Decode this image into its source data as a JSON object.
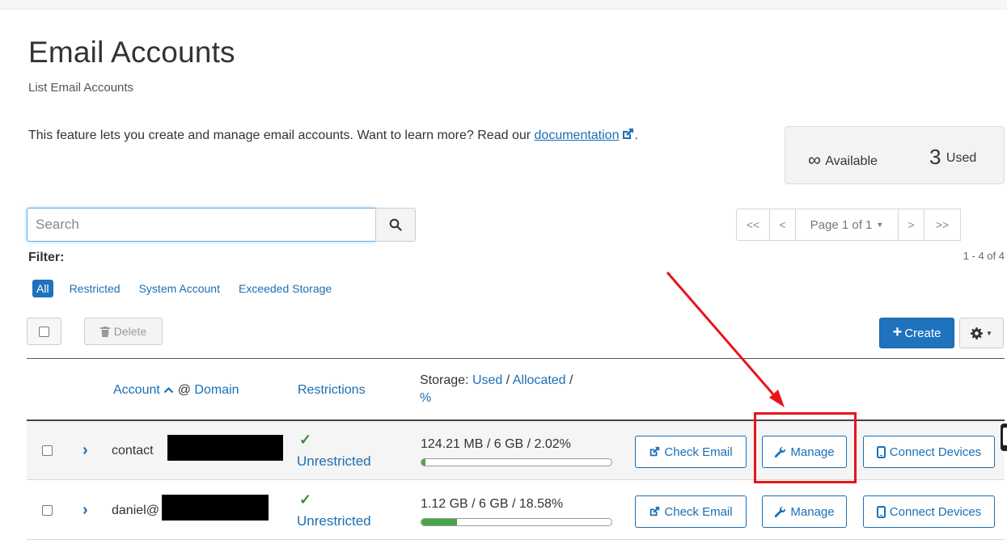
{
  "page": {
    "title": "Email Accounts",
    "subtitle": "List Email Accounts",
    "intro_text": "This feature lets you create and manage email accounts. Want to learn more? Read our ",
    "intro_link": "documentation",
    "intro_tail": "."
  },
  "stats": {
    "available_symbol": "∞",
    "available_label": "Available",
    "used_count": "3",
    "used_label": "Used"
  },
  "search": {
    "placeholder": "Search"
  },
  "pagination": {
    "first": "<<",
    "prev": "<",
    "page_label": "Page 1 of 1",
    "next": ">",
    "last": ">>",
    "range": "1 - 4 of 4"
  },
  "filter": {
    "label": "Filter:",
    "options": [
      "All",
      "Restricted",
      "System Account",
      "Exceeded Storage"
    ]
  },
  "toolbar": {
    "delete_label": "Delete",
    "create_label": "Create"
  },
  "table": {
    "header_account": "Account",
    "header_at": " @ ",
    "header_domain": "Domain",
    "header_restrictions": "Restrictions",
    "header_storage_prefix": "Storage: ",
    "header_used": "Used",
    "header_sep1": " / ",
    "header_allocated": "Allocated",
    "header_sep2": " / ",
    "header_percent": "%",
    "rows": [
      {
        "account": "contact",
        "restriction": "Unrestricted",
        "storage": "124.21 MB / 6 GB / 2.02%",
        "usage_fraction": 0.0202,
        "check_email": "Check Email",
        "manage": "Manage",
        "connect": "Connect Devices"
      },
      {
        "account": "daniel@",
        "restriction": "Unrestricted",
        "storage": "1.12 GB / 6 GB / 18.58%",
        "usage_fraction": 0.1858,
        "check_email": "Check Email",
        "manage": "Manage",
        "connect": "Connect Devices"
      }
    ]
  },
  "colors": {
    "primary": "#1f72bd",
    "link": "#1a6fb5",
    "success": "#48a64a",
    "annotation": "#e8141a"
  }
}
